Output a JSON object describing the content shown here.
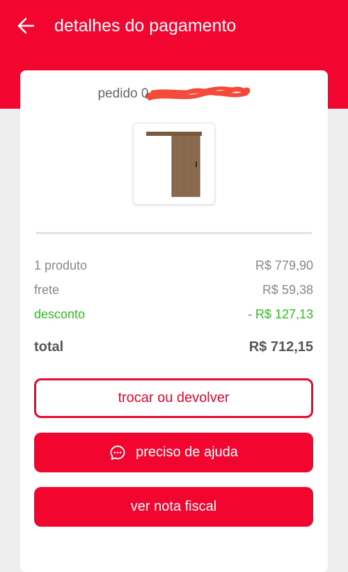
{
  "header": {
    "title": "detalhes do pagamento"
  },
  "order": {
    "label": "pedido 0"
  },
  "summary": {
    "products_label": "1 produto",
    "products_value": "R$ 779,90",
    "shipping_label": "frete",
    "shipping_value": "R$ 59,38",
    "discount_label": "desconto",
    "discount_value": "- R$ 127,13",
    "total_label": "total",
    "total_value": "R$ 712,15"
  },
  "actions": {
    "exchange_label": "trocar ou devolver",
    "help_label": "preciso de ajuda",
    "invoice_label": "ver nota fiscal"
  },
  "colors": {
    "brand_red": "#f2052e",
    "discount_green": "#2fbf20"
  },
  "icons": {
    "back": "arrow-left-icon",
    "help": "chat-bubble-icon"
  }
}
